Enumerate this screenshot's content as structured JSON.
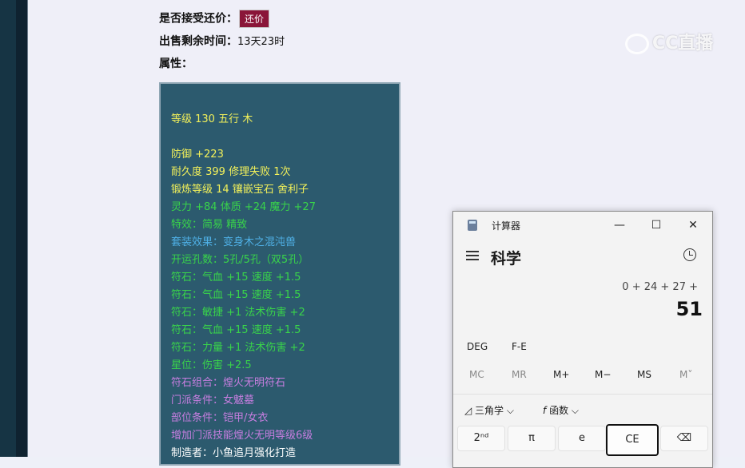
{
  "listing": {
    "bargain_label": "是否接受还价：",
    "bargain_button": "还价",
    "time_label": "出售剩余时间：",
    "time_value": "13天23时",
    "attr_label": "属性："
  },
  "attributes": [
    {
      "text": "等级 130 五行 木",
      "color": "#f2f05a"
    },
    {
      "text": "防御 +223",
      "color": "#f2f05a"
    },
    {
      "text": "耐久度 399 修理失败 1次",
      "color": "#f2f05a"
    },
    {
      "text": "锻炼等级 14 镶嵌宝石 舍利子",
      "color": "#f2f05a"
    },
    {
      "text": "灵力 +84 体质 +24 魔力 +27",
      "color": "#39d44a"
    },
    {
      "text": "特效：简易 精致",
      "color": "#39d44a"
    },
    {
      "text": "套装效果：变身木之混沌兽",
      "color": "#4fb0e6"
    },
    {
      "text": "开运孔数：5孔/5孔（双5孔）",
      "color": "#39d44a"
    },
    {
      "text": "符石：气血 +15 速度 +1.5",
      "color": "#39d44a"
    },
    {
      "text": "符石：气血 +15 速度 +1.5",
      "color": "#39d44a"
    },
    {
      "text": "符石：敏捷 +1 法术伤害 +2",
      "color": "#39d44a"
    },
    {
      "text": "符石：气血 +15 速度 +1.5",
      "color": "#39d44a"
    },
    {
      "text": "符石：力量 +1 法术伤害 +2",
      "color": "#39d44a"
    },
    {
      "text": "星位：伤害 +2.5",
      "color": "#39d44a"
    },
    {
      "text": "符石组合：煌火无明符石",
      "color": "#c77ee0"
    },
    {
      "text": "门派条件：女魃墓",
      "color": "#c77ee0"
    },
    {
      "text": "部位条件：铠甲/女衣",
      "color": "#c77ee0"
    },
    {
      "text": "增加门派技能煌火无明等级6级",
      "color": "#c77ee0"
    },
    {
      "text": "制造者：小鱼追月强化打造",
      "color": "#ffffff"
    }
  ],
  "watermark": "CC直播",
  "calculator": {
    "app_title": "计算器",
    "mode": "科学",
    "expression": "0 + 24 + 27 +",
    "result": "51",
    "deg": "DEG",
    "fe": "F-E",
    "memory": [
      "MC",
      "MR",
      "M+",
      "M−",
      "MS",
      "M˅"
    ],
    "trig_label": "三角学",
    "func_label": "函数",
    "keys": [
      "2ⁿᵈ",
      "π",
      "e",
      "CE",
      "⌫"
    ],
    "icons": {
      "minimize": "minimize-icon",
      "maximize": "maximize-icon",
      "close": "close-icon"
    }
  }
}
